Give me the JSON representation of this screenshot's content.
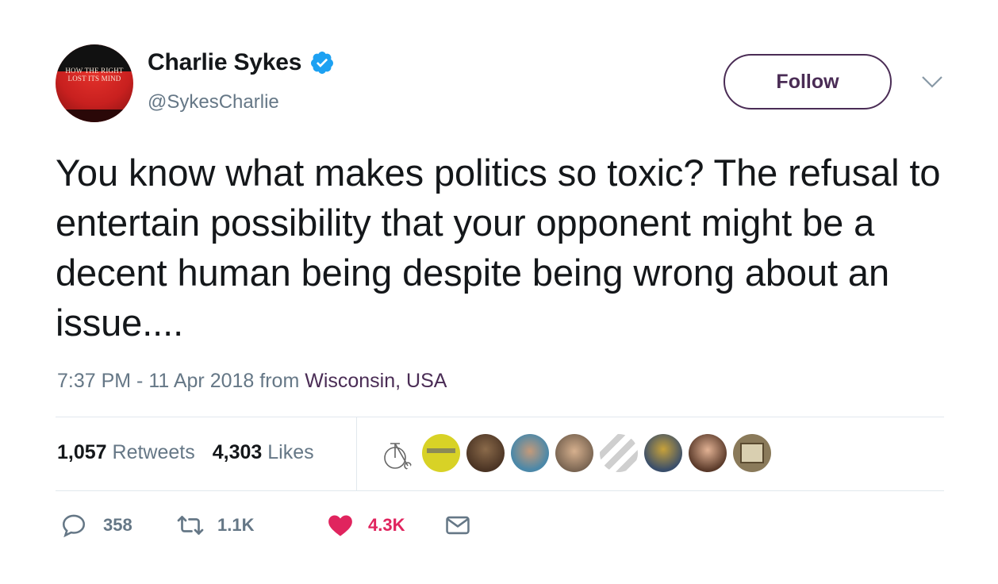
{
  "author": {
    "display_name": "Charlie Sykes",
    "handle": "@SykesCharlie",
    "avatar_text_line1": "HOW THE RIGHT",
    "avatar_text_line2": "LOST ITS MIND",
    "verified": true
  },
  "header": {
    "follow_label": "Follow"
  },
  "tweet": {
    "text": "You know what makes politics so toxic? The refusal to entertain possibility that your opponent might be a decent human being despite being wrong about an issue....",
    "timestamp": "7:37 PM - 11 Apr 2018",
    "from_word": "from",
    "location": "Wisconsin, USA"
  },
  "stats": {
    "retweets_count": "1,057",
    "retweets_label": "Retweets",
    "likes_count": "4,303",
    "likes_label": "Likes"
  },
  "actions": {
    "reply_count": "358",
    "retweet_count": "1.1K",
    "like_count": "4.3K"
  },
  "colors": {
    "brand_purple": "#4a2c55",
    "verified_blue": "#1da1f2",
    "like_red": "#e0245e",
    "secondary_text": "#657786"
  }
}
